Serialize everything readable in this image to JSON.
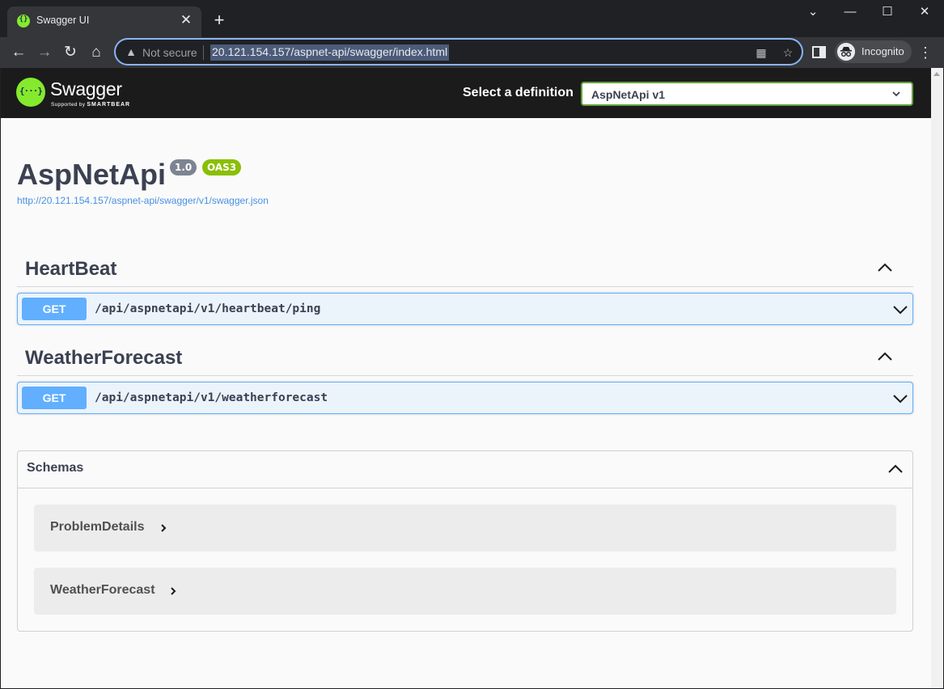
{
  "browser": {
    "tab_title": "Swagger UI",
    "tab_close": "✕",
    "new_tab": "+",
    "window_controls": [
      "⌄",
      "—",
      "☐",
      "✕"
    ],
    "nav": {
      "back": "←",
      "forward": "→",
      "reload": "↻",
      "home": "⌂"
    },
    "security_label": "Not secure",
    "url": "20.121.154.157/aspnet-api/swagger/index.html",
    "profile_label": "Incognito",
    "menu": "⋮"
  },
  "topbar": {
    "brand": "Swagger",
    "brand_sub_prefix": "Supported by",
    "brand_sub_name": "SMARTBEAR",
    "definition_label": "Select a definition",
    "definition_selected": "AspNetApi v1"
  },
  "info": {
    "title": "AspNetApi",
    "version": "1.0",
    "oas": "OAS3",
    "spec_url": "http://20.121.154.157/aspnet-api/swagger/v1/swagger.json"
  },
  "tags": [
    {
      "name": "HeartBeat",
      "operations": [
        {
          "method": "GET",
          "path": "/api/aspnetapi/v1/heartbeat/ping"
        }
      ]
    },
    {
      "name": "WeatherForecast",
      "operations": [
        {
          "method": "GET",
          "path": "/api/aspnetapi/v1/weatherforecast"
        }
      ]
    }
  ],
  "schemas": {
    "title": "Schemas",
    "models": [
      "ProblemDetails",
      "WeatherForecast"
    ]
  },
  "colors": {
    "get_method": "#61affe",
    "oas_badge": "#89bf04",
    "swagger_green": "#85ea2d"
  }
}
